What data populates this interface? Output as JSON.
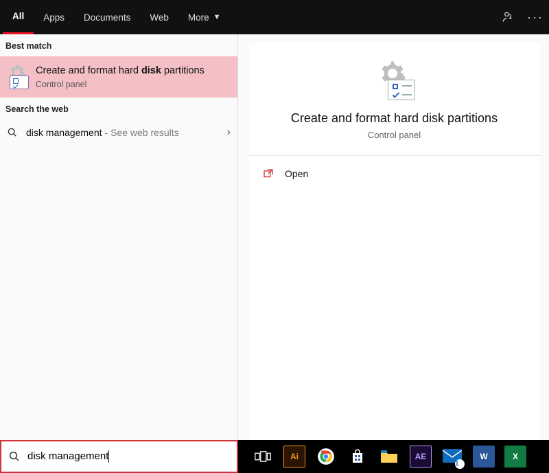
{
  "filters": {
    "all": "All",
    "apps": "Apps",
    "documents": "Documents",
    "web": "Web",
    "more": "More"
  },
  "sections": {
    "best_match": "Best match",
    "search_web": "Search the web"
  },
  "best_match": {
    "title_prefix": "Create and format hard ",
    "title_bold": "disk",
    "title_suffix": " partitions",
    "subtitle": "Control panel"
  },
  "web": {
    "query": "disk management",
    "hint": "- See web results"
  },
  "preview": {
    "title": "Create and format hard disk partitions",
    "subtitle": "Control panel",
    "open": "Open"
  },
  "search": {
    "value": "disk management"
  },
  "taskbar": {
    "items": [
      {
        "name": "task-view-icon",
        "label": ""
      },
      {
        "name": "illustrator-icon",
        "label": "Ai"
      },
      {
        "name": "chrome-icon",
        "label": ""
      },
      {
        "name": "ms-store-icon",
        "label": ""
      },
      {
        "name": "file-explorer-icon",
        "label": ""
      },
      {
        "name": "after-effects-icon",
        "label": "AE"
      },
      {
        "name": "mail-icon",
        "label": ""
      },
      {
        "name": "word-icon",
        "label": "W"
      },
      {
        "name": "excel-icon",
        "label": "X"
      }
    ]
  }
}
